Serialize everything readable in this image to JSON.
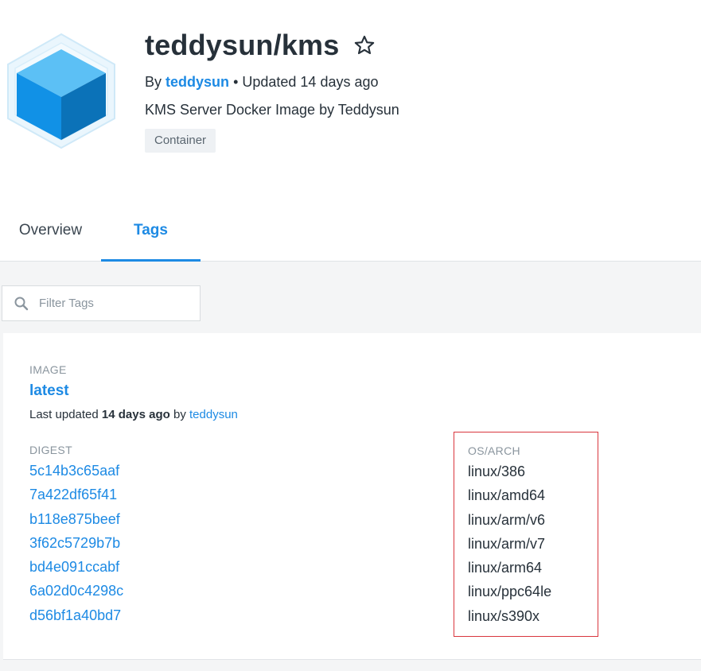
{
  "repo": {
    "title": "teddysun/kms",
    "by_prefix": "By",
    "author": "teddysun",
    "updated_text": "• Updated 14 days ago",
    "description": "KMS Server Docker Image by Teddysun",
    "badge": "Container",
    "star_icon": "star-outline-icon",
    "logo_icon": "container-cube-icon"
  },
  "tabs": [
    {
      "label": "Overview",
      "active": false
    },
    {
      "label": "Tags",
      "active": true
    }
  ],
  "filter": {
    "placeholder": "Filter Tags",
    "icon": "search-icon",
    "value": ""
  },
  "image": {
    "section_label": "IMAGE",
    "tag": "latest",
    "updated_prefix": "Last updated",
    "updated_when": "14 days ago",
    "updated_by_prefix": "by",
    "updated_by": "teddysun",
    "digest_header": "DIGEST",
    "osarch_header": "OS/ARCH",
    "digests": [
      "5c14b3c65aaf",
      "7a422df65f41",
      "b118e875beef",
      "3f62c5729b7b",
      "bd4e091ccabf",
      "6a02d0c4298c",
      "d56bf1a40bd7"
    ],
    "platforms": [
      "linux/386",
      "linux/amd64",
      "linux/arm/v6",
      "linux/arm/v7",
      "linux/arm64",
      "linux/ppc64le",
      "linux/s390x"
    ]
  },
  "colors": {
    "accent": "#1d8ae4",
    "highlight_box": "#d9363e",
    "text": "#27313a",
    "muted": "#8a959e",
    "panel_bg": "#f4f5f6"
  }
}
